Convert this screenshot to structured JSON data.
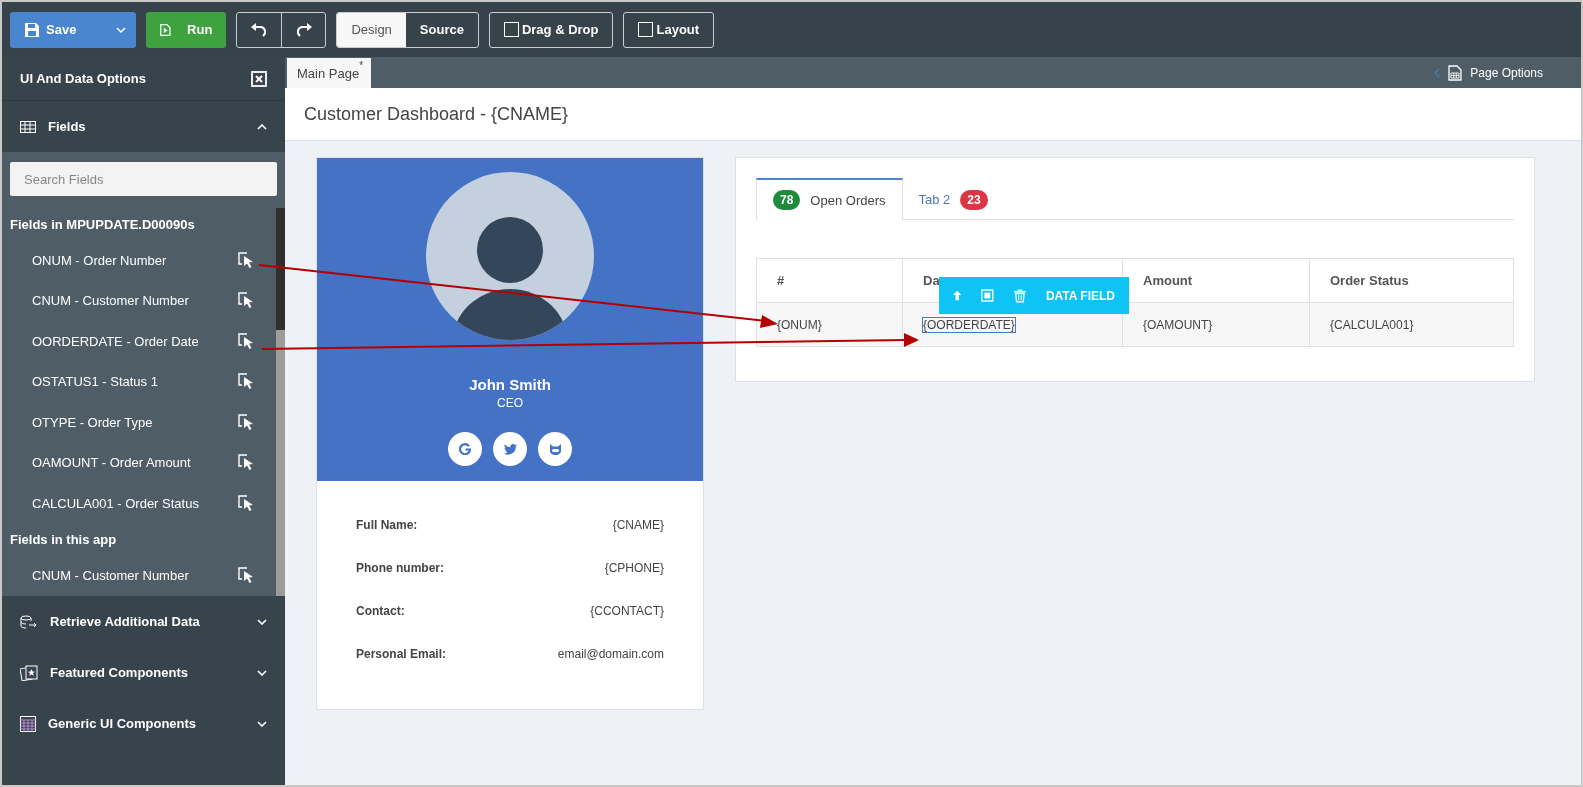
{
  "toolbar": {
    "save": "Save",
    "run": "Run",
    "views": [
      {
        "label": "Design",
        "selected": true
      },
      {
        "label": "Source",
        "selected": false
      }
    ],
    "toggles": [
      {
        "label": "Drag & Drop",
        "checked": false
      },
      {
        "label": "Layout",
        "checked": false
      }
    ]
  },
  "sidebar": {
    "title": "UI And Data Options",
    "sections": [
      {
        "kind": "fields",
        "label": "Fields",
        "expanded": true,
        "search": {
          "placeholder": "Search Fields"
        },
        "groups": [
          {
            "heading": "Fields in MPUPDATE.D00090s",
            "fields": [
              "ONUM - Order Number",
              "CNUM - Customer Number",
              "OORDERDATE - Order Date",
              "OSTATUS1 - Status 1",
              "OTYPE - Order Type",
              "OAMOUNT - Order Amount",
              "CALCULA001 - Order Status"
            ]
          },
          {
            "heading": "Fields in this app",
            "fields": [
              "CNUM - Customer Number"
            ]
          }
        ]
      },
      {
        "kind": "data",
        "label": "Retrieve Additional Data",
        "expanded": false
      },
      {
        "kind": "featured",
        "label": "Featured Components",
        "expanded": false
      },
      {
        "kind": "generic",
        "label": "Generic UI Components",
        "expanded": false
      }
    ]
  },
  "page_tab": {
    "label": "Main Page",
    "mark": "*"
  },
  "page_options": "Page Options",
  "page_title": "Customer Dashboard - {CNAME}",
  "profile": {
    "name": "John Smith",
    "role": "CEO",
    "details": [
      {
        "label": "Full Name:",
        "value": "{CNAME}"
      },
      {
        "label": "Phone number:",
        "value": "{CPHONE}"
      },
      {
        "label": "Contact:",
        "value": "{CCONTACT}"
      },
      {
        "label": "Personal Email:",
        "value": "email@domain.com"
      }
    ]
  },
  "orders": {
    "tabs": [
      {
        "label": "Open Orders",
        "count": "78",
        "color": "#1e8a3a",
        "selected": true
      },
      {
        "label": "Tab 2",
        "count": "23",
        "color": "#dc3545",
        "selected": false
      }
    ],
    "columns": [
      "#",
      "Da",
      "Amount",
      "Order Status"
    ],
    "rows": [
      [
        {
          "text": "{ONUM}",
          "selected": false
        },
        {
          "text": "{OORDERDATE}",
          "selected": true
        },
        {
          "text": "{OAMOUNT}",
          "selected": false
        },
        {
          "text": "{CALCULA001}",
          "selected": false
        }
      ]
    ],
    "field_toolbar": {
      "label": "DATA FIELD"
    }
  }
}
